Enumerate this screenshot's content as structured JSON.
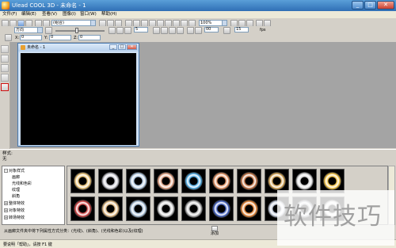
{
  "window": {
    "title": "Ulead COOL 3D - 未命名 - 1"
  },
  "menu": [
    "文件(F)",
    "编辑(E)",
    "查看(V)",
    "图像(I)",
    "窗口(W)",
    "帮助(H)"
  ],
  "toolbar": {
    "style_combo": "(组合)",
    "zoom": "100%",
    "direction_combo": "方向",
    "frame_spin": "5",
    "time_spin": "00",
    "fps_spin": "15",
    "fps_label": "fps",
    "x_label": "X:",
    "x_value": "0",
    "y_label": "Y:",
    "y_value": "0",
    "z_label": "Z:",
    "z_value": "0"
  },
  "document": {
    "title": "未命名 - 1"
  },
  "properties": {
    "label": "样式:",
    "value": "无"
  },
  "tree": [
    {
      "label": "对象样式",
      "expanded": true
    },
    {
      "label": "画廊",
      "indent": true
    },
    {
      "label": "光线和色彩",
      "indent": true
    },
    {
      "label": "纹理",
      "indent": true
    },
    {
      "label": "斜角",
      "indent": true
    },
    {
      "label": "整体特效",
      "expanded": false
    },
    {
      "label": "对象特效",
      "expanded": false
    },
    {
      "label": "转场特效",
      "expanded": false
    }
  ],
  "hint": {
    "text": "从画廊文件夹中将下列属性方式分类：(光线)、(斜角)、(光线和色彩)以及(纹理)",
    "add_label": "添加"
  },
  "status": {
    "text": "要说明「帮助」，请按 F1 键"
  },
  "watermark": {
    "text": "软件技巧"
  },
  "thumb_colors": [
    "#e8c070",
    "#c8c8d0",
    "#b0c8e0",
    "#e0a080",
    "#4aa8e0",
    "#e09060",
    "#c07040",
    "#d0a050",
    "#d8d8d8",
    "#f0c040",
    "#d04040",
    "#e0b880",
    "#a8c0d8",
    "#c8c8c8",
    "#b8b8b8",
    "#4060c0",
    "#e08030",
    "#c0c8d8",
    "#a0a8b0",
    "#d0d0d0"
  ]
}
